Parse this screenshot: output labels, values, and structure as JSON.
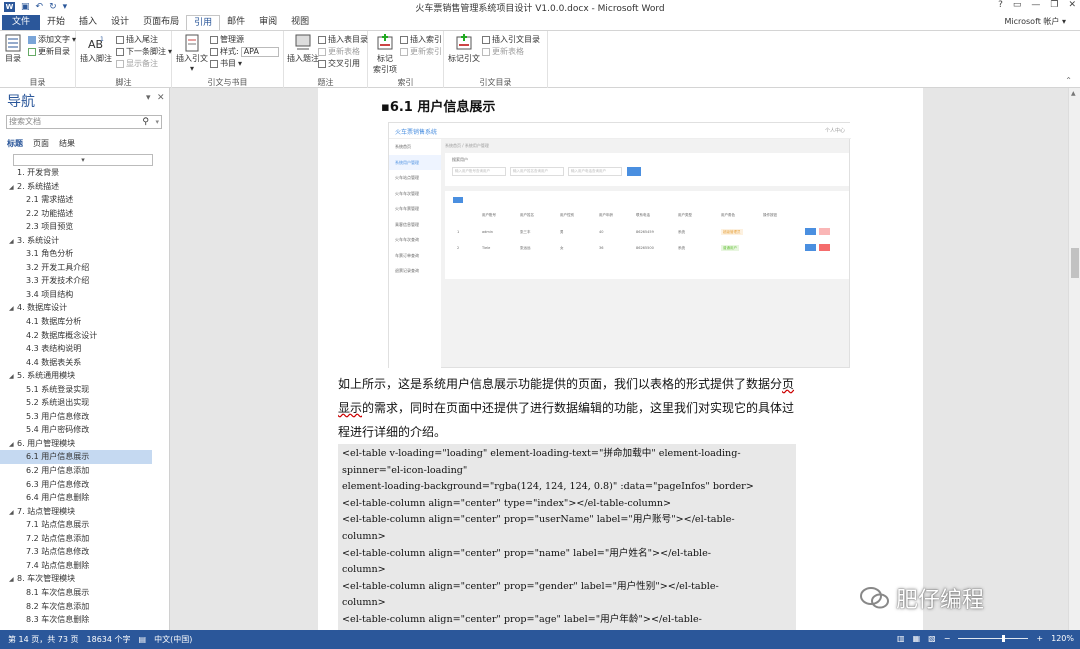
{
  "app": {
    "title": "火车票销售管理系统项目设计 V1.0.0.docx - Microsoft Word",
    "account": "Microsoft 帐户",
    "window_controls": [
      "?",
      "▭",
      "—",
      "❐",
      "✕"
    ]
  },
  "ribbon": {
    "tabs": [
      "文件",
      "开始",
      "插入",
      "设计",
      "页面布局",
      "引用",
      "邮件",
      "审阅",
      "视图"
    ],
    "active_tab": "引用",
    "groups": {
      "toc": {
        "label": "目录",
        "big": "目录",
        "add_text": "添加文字",
        "update_toc": "更新目录"
      },
      "footnote": {
        "label": "脚注",
        "big": "插入脚注",
        "insert_endnote": "插入尾注",
        "next_footnote": "下一条脚注",
        "show_notes": "显示备注"
      },
      "citation": {
        "label": "引文与书目",
        "big": "插入引文",
        "manage": "管理源",
        "style_label": "样式:",
        "style_value": "APA",
        "bibliography": "书目"
      },
      "caption": {
        "label": "题注",
        "big": "插入题注",
        "table_of_figures": "插入表目录",
        "update_table": "更新表格",
        "cross_ref": "交叉引用"
      },
      "index": {
        "label": "索引",
        "big": "标记\n索引项",
        "insert_index": "插入索引",
        "update_index": "更新索引"
      },
      "authorities": {
        "label": "引文目录",
        "big": "标记引文",
        "insert_toa": "插入引文目录",
        "update_table": "更新表格"
      }
    }
  },
  "nav": {
    "title": "导航",
    "search_placeholder": "搜索文档",
    "tabs": [
      "标题",
      "页面",
      "结果"
    ],
    "items": [
      {
        "text": "1. 开发背景",
        "level": 1,
        "expandable": false
      },
      {
        "text": "2. 系统描述",
        "level": 1,
        "expandable": true
      },
      {
        "text": "2.1 需求描述",
        "level": 2
      },
      {
        "text": "2.2 功能描述",
        "level": 2
      },
      {
        "text": "2.3 项目预览",
        "level": 2
      },
      {
        "text": "3. 系统设计",
        "level": 1,
        "expandable": true
      },
      {
        "text": "3.1 角色分析",
        "level": 2
      },
      {
        "text": "3.2 开发工具介绍",
        "level": 2
      },
      {
        "text": "3.3 开发技术介绍",
        "level": 2
      },
      {
        "text": "3.4 项目结构",
        "level": 2
      },
      {
        "text": "4. 数据库设计",
        "level": 1,
        "expandable": true
      },
      {
        "text": "4.1 数据库分析",
        "level": 2
      },
      {
        "text": "4.2 数据库概念设计",
        "level": 2
      },
      {
        "text": "4.3 表结构说明",
        "level": 2
      },
      {
        "text": "4.4 数据表关系",
        "level": 2
      },
      {
        "text": "5. 系统通用模块",
        "level": 1,
        "expandable": true
      },
      {
        "text": "5.1 系统登录实现",
        "level": 2
      },
      {
        "text": "5.2 系统退出实现",
        "level": 2
      },
      {
        "text": "5.3 用户信息修改",
        "level": 2
      },
      {
        "text": "5.4 用户密码修改",
        "level": 2
      },
      {
        "text": "6. 用户管理模块",
        "level": 1,
        "expandable": true
      },
      {
        "text": "6.1 用户信息展示",
        "level": 2,
        "selected": true
      },
      {
        "text": "6.2 用户信息添加",
        "level": 2
      },
      {
        "text": "6.3 用户信息修改",
        "level": 2
      },
      {
        "text": "6.4 用户信息删除",
        "level": 2
      },
      {
        "text": "7. 站点管理模块",
        "level": 1,
        "expandable": true
      },
      {
        "text": "7.1 站点信息展示",
        "level": 2
      },
      {
        "text": "7.2 站点信息添加",
        "level": 2
      },
      {
        "text": "7.3 站点信息修改",
        "level": 2
      },
      {
        "text": "7.4 站点信息删除",
        "level": 2
      },
      {
        "text": "8. 车次管理模块",
        "level": 1,
        "expandable": true
      },
      {
        "text": "8.1 车次信息展示",
        "level": 2
      },
      {
        "text": "8.2 车次信息添加",
        "level": 2
      },
      {
        "text": "8.3 车次信息删除",
        "level": 2
      }
    ]
  },
  "document": {
    "heading": "6.1  用户信息展示",
    "screenshot": {
      "brand": "火车票销售系统",
      "user": "个人中心",
      "breadcrumb": "系统首页  /  系统用户管理",
      "menu": [
        "系统首页",
        "系统用户管理",
        "火车站点管理",
        "火车车次管理",
        "火车车票管理",
        "乘客信息管理",
        "火车车次查询",
        "车票订单查询",
        "退票记录查询"
      ],
      "search_label": "搜索用户",
      "search_placeholders": [
        "输入用户账号查询用户",
        "输入用户姓名查询用户",
        "输入用户电话查询用户"
      ],
      "table_headers": [
        "",
        "用户账号",
        "用户姓名",
        "用户性别",
        "用户年龄",
        "联系电话",
        "用户类型",
        "用户角色",
        "操作按钮"
      ],
      "rows": [
        [
          "1",
          "admin",
          "张三丰",
          "男",
          "40",
          "86265459",
          "系统",
          "超级管理员"
        ],
        [
          "2",
          "Tiele",
          "张远远",
          "女",
          "36",
          "86265500",
          "系统",
          "普通用户"
        ]
      ]
    },
    "para_lines": [
      [
        "如上所示，这是系统用户信息展示功能提供的页面，我们以表格的形式提供了数据分",
        "页"
      ],
      [
        "",
        "显示",
        "的需求，同时在页面中还提供了进行数据编辑的功能，这里我们对实现它的具体过"
      ],
      [
        "程进行详细的介绍。"
      ]
    ],
    "code_lines": [
      "<el-table  v-loading=\"loading\"  element-loading-text=\"拼命加载中\"  element-loading-",
      "spinner=\"el-icon-loading\"",
      "    element-loading-background=\"rgba(124, 124, 124, 0.8)\" :data=\"pageInfos\" border>",
      "    <el-table-column align=\"center\" type=\"index\"></el-table-column>",
      "        <el-table-column align=\"center\" prop=\"userName\" label=\"用户账号\"></el-table-",
      "column>",
      "        <el-table-column  align=\"center\"  prop=\"name\"  label=\"用户姓名\"></el-table-",
      "column>",
      "        <el-table-column  align=\"center\"  prop=\"gender\" label=\"用户性别\"></el-table-",
      "column>",
      "        <el-table-column  align=\"center\"  prop=\"age\"  label=\"用户年龄\"></el-table-"
    ]
  },
  "watermark": "肥仔编程",
  "status": {
    "page": "第 14 页，共 73 页",
    "words": "18634 个字",
    "lang": "中文(中国)",
    "zoom": "120%",
    "zoom_fraction": 0.62
  },
  "colors": {
    "word_blue": "#2b579a",
    "link_blue": "#4a8fe0",
    "selection": "#c5d9f1"
  }
}
